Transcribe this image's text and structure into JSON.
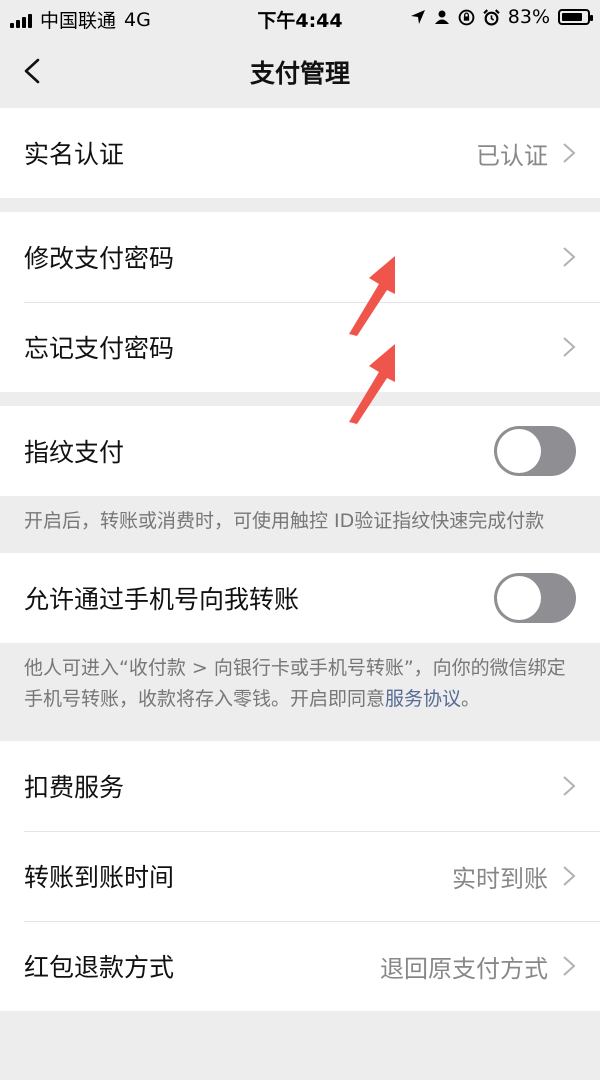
{
  "status": {
    "carrier": "中国联通",
    "network": "4G",
    "time": "下午4:44",
    "battery": "83%",
    "battery_level": 0.83
  },
  "nav": {
    "title": "支付管理"
  },
  "identity": {
    "label": "实名认证",
    "value": "已认证"
  },
  "password": [
    {
      "label": "修改支付密码"
    },
    {
      "label": "忘记支付密码"
    }
  ],
  "fingerprint": {
    "label": "指纹支付",
    "enabled": false,
    "note": "开启后，转账或消费时，可使用触控 ID验证指纹快速完成付款"
  },
  "phone_transfer": {
    "label": "允许通过手机号向我转账",
    "enabled": false,
    "note_text": "他人可进入“收付款 > 向银行卡或手机号转账”，向你的微信绑定手机号转账，收款将存入零钱。开启即同意",
    "note_link": "服务协议",
    "note_end": "。"
  },
  "services": [
    {
      "label": "扣费服务",
      "value": ""
    },
    {
      "label": "转账到账时间",
      "value": "实时到账"
    },
    {
      "label": "红包退款方式",
      "value": "退回原支付方式"
    }
  ],
  "colors": {
    "link": "#576b95",
    "annotation_arrow": "#f0554b",
    "toggle_off": "#8e8e93"
  }
}
